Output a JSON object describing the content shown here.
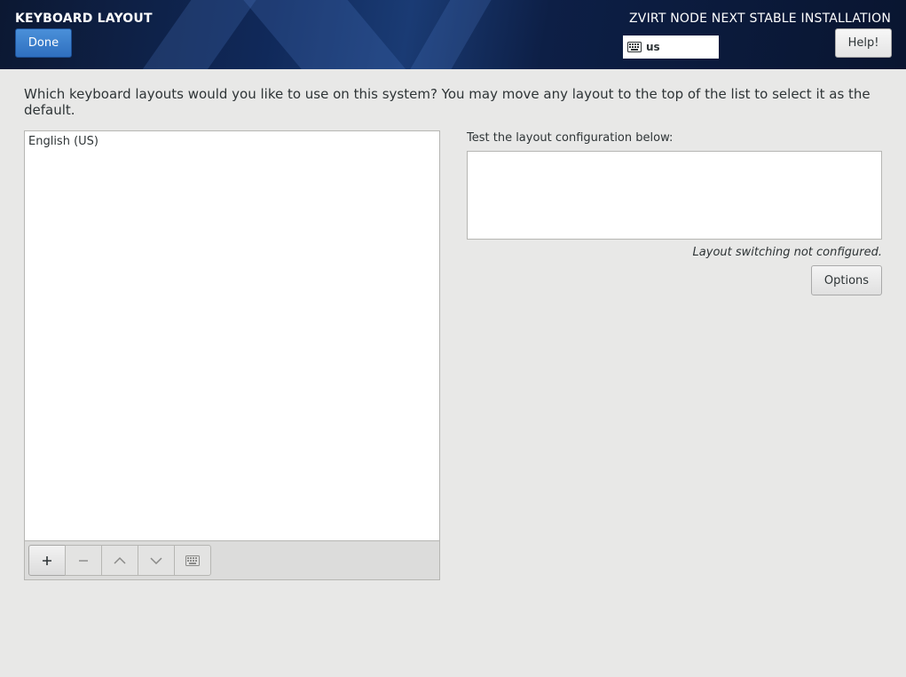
{
  "header": {
    "title": "KEYBOARD LAYOUT",
    "done_label": "Done",
    "product_title": "ZVIRT NODE NEXT STABLE INSTALLATION",
    "keyboard_indicator": "us",
    "help_label": "Help!"
  },
  "main": {
    "question": "Which keyboard layouts would you like to use on this system?  You may move any layout to the top of the list to select it as the default.",
    "layouts": [
      "English (US)"
    ],
    "toolbar_icons": [
      "plus-icon",
      "minus-icon",
      "chevron-up-icon",
      "chevron-down-icon",
      "keyboard-icon"
    ],
    "test_label": "Test the layout configuration below:",
    "test_value": "",
    "switching_note": "Layout switching not configured.",
    "options_label": "Options"
  },
  "colors": {
    "header_bg": "#0c1832",
    "accent_button": "#2f6fbf",
    "page_bg": "#e8e8e7"
  }
}
